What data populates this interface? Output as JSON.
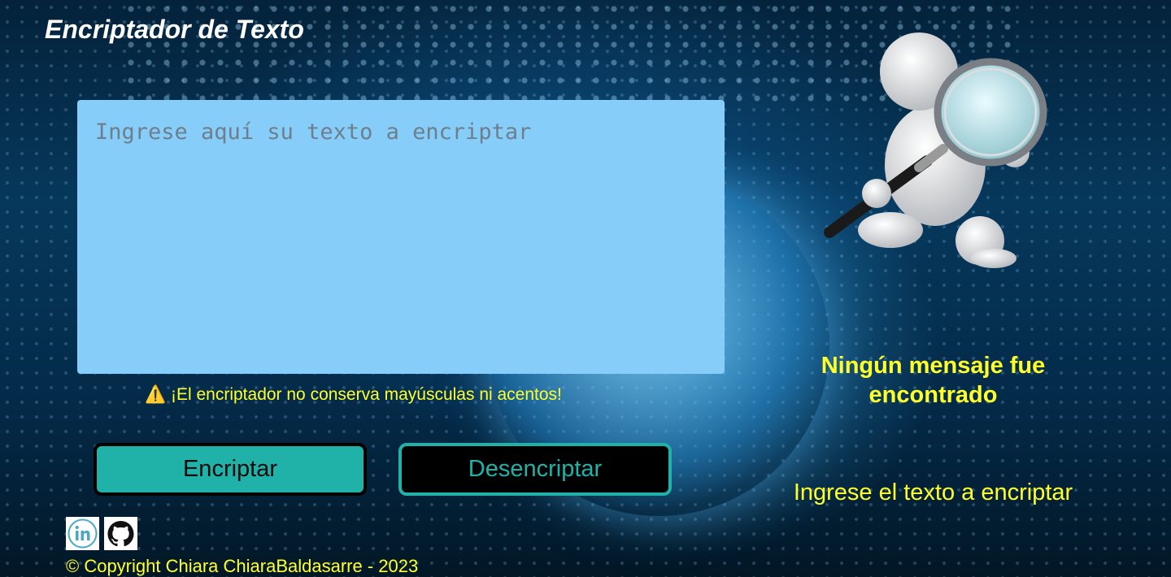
{
  "header": {
    "title": "Encriptador de Texto"
  },
  "input": {
    "placeholder": "Ingrese aquí su texto a encriptar",
    "value": ""
  },
  "warning": {
    "icon": "warning-icon",
    "text": "⚠️ ¡El encriptador no conserva mayúsculas ni acentos!"
  },
  "buttons": {
    "encrypt_label": "Encriptar",
    "decrypt_label": "Desencriptar"
  },
  "output": {
    "title": "Ningún mensaje fue encontrado",
    "subtitle": "Ingrese el texto a encriptar"
  },
  "social": {
    "linkedin_icon": "linkedin-icon",
    "github_icon": "github-icon"
  },
  "footer": {
    "copyright": "© Copyright Chiara ChiaraBaldasarre - 2023"
  },
  "colors": {
    "accent_teal": "#20b2a8",
    "text_yellow": "#ffff2a",
    "input_bg": "#87cdf9",
    "title_white": "#ffffff"
  }
}
